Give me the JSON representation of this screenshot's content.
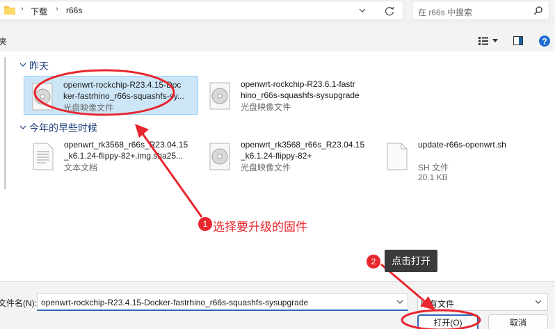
{
  "address_bar": {
    "crumbs": [
      "下载",
      "r66s"
    ],
    "search_placeholder": "在 r66s 中搜索"
  },
  "toolbar": {
    "left_label": "夹"
  },
  "groups": [
    {
      "header": "昨天",
      "files": [
        {
          "name": "openwrt-rockchip-R23.4.15-Doc\nker-fastrhino_r66s-squashfs-sy...",
          "type": "光盘映像文件",
          "size": "",
          "icon": "disc-image-icon",
          "selected": true
        },
        {
          "name": "openwrt-rockchip-R23.6.1-fastr\nhino_r66s-squashfs-sysupgrade",
          "type": "光盘映像文件",
          "size": "",
          "icon": "disc-image-icon",
          "selected": false
        }
      ]
    },
    {
      "header": "今年的早些时候",
      "files": [
        {
          "name": "openwrt_rk3568_r66s_R23.04.15\n_k6.1.24-flippy-82+.img.sha25...",
          "type": "文本文档",
          "size": "",
          "icon": "text-document-icon",
          "selected": false
        },
        {
          "name": "openwrt_rk3568_r66s_R23.04.15\n_k6.1.24-flippy-82+",
          "type": "光盘映像文件",
          "size": "",
          "icon": "disc-image-icon",
          "selected": false
        },
        {
          "name": "update-r66s-openwrt.sh",
          "type": "SH 文件",
          "size": "20.1 KB",
          "icon": "script-file-icon",
          "selected": false
        }
      ]
    }
  ],
  "bottom": {
    "filename_label": "文件名(N):",
    "filename_value": "openwrt-rockchip-R23.4.15-Docker-fastrhino_r66s-squashfs-sysupgrade",
    "filetype_value": "所有文件",
    "open_label": "打开(O)",
    "cancel_label": "取消"
  },
  "annotations": {
    "step1_number": "1",
    "step1_text": "选择要升级的固件",
    "step2_number": "2",
    "step2_text": "点击打开"
  },
  "colors": {
    "accent": "#2a64b8",
    "selection": "#cde6f7",
    "annotation_red": "#e8262d"
  }
}
